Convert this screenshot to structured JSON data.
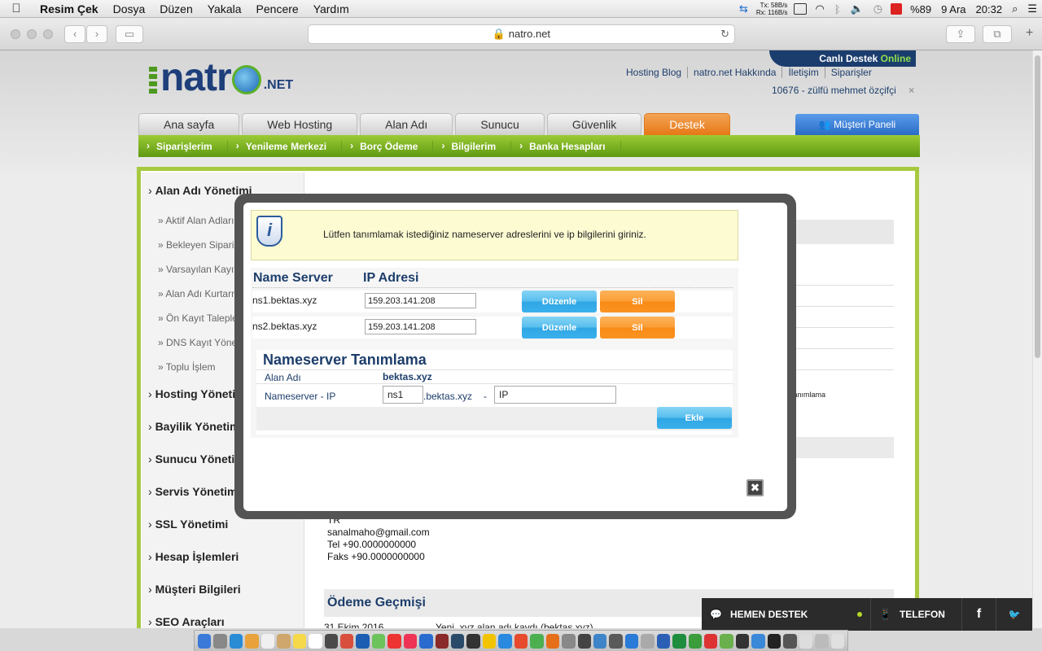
{
  "menubar": {
    "app": "Resim Çek",
    "items": [
      "Dosya",
      "Düzen",
      "Yakala",
      "Pencere",
      "Yardım"
    ],
    "net_tx_label": "Tx:",
    "net_rx_label": "Rx:",
    "net_tx": "58B/s",
    "net_rx": "116B/s",
    "battery": "%89",
    "date": "9 Ara",
    "time": "20:32"
  },
  "browser": {
    "url": "natro.net"
  },
  "site": {
    "logo_word": "natr",
    "logo_suffix": ".NET",
    "canli_prefix": "Canlı Destek",
    "canli_status": "Online",
    "toplinks": [
      "Hosting Blog",
      "natro.net Hakkında",
      "İletişim",
      "Siparişler"
    ],
    "user": "10676 - zülfü mehmet özçifçi",
    "close_mark": "×",
    "tabs": [
      "Ana sayfa",
      "Web Hosting",
      "Alan Adı",
      "Sunucu",
      "Güvenlik",
      "Destek"
    ],
    "subnav": [
      "Siparişlerim",
      "Yenileme Merkezi",
      "Borç Ödeme",
      "Bilgilerim",
      "Banka Hesapları"
    ],
    "musteri_paneli": "Müşteri Paneli"
  },
  "sidebar": {
    "heading_main": "Alan Adı Yönetimi",
    "sub_items": [
      "Aktif Alan Adları",
      "Bekleyen Siparişler",
      "Varsayılan Kayıt Bilgileri",
      "Alan Adı Kurtarma",
      "Ön Kayıt Talepleri",
      "DNS Kayıt Yönetimi",
      "Toplu İşlem"
    ],
    "headings": [
      "Hosting Yönetimi",
      "Bayilik Yönetimi",
      "Sunucu Yönetimi",
      "Servis Yönetimi",
      "SSL Yönetimi",
      "Hesap İşlemleri",
      "Müşteri Bilgileri",
      "SEO Araçları"
    ]
  },
  "background": {
    "country": "TR",
    "email": "sanalmaho@gmail.com",
    "tel": "Tel +90.0000000000",
    "faks": "Faks +90.0000000000",
    "odeme_title": "Ödeme Geçmişi",
    "odeme_date": "31 Ekim 2016",
    "odeme_desc": "Yeni .xyz alan adı kaydı (bektas.xyz)",
    "tanimlama": "Tanımlama"
  },
  "modal": {
    "info_message": "Lütfen tanımlamak istediğiniz nameserver adreslerini ve ip bilgilerini giriniz.",
    "col_ns": "Name Server",
    "col_ip": "IP Adresi",
    "rows": [
      {
        "ns": "ns1.bektas.xyz",
        "ip": "159.203.141.208"
      },
      {
        "ns": "ns2.bektas.xyz",
        "ip": "159.203.141.208"
      }
    ],
    "edit_label": "Düzenle",
    "delete_label": "Sil",
    "define_title": "Nameserver Tanımlama",
    "domain_label": "Alan Adı",
    "domain_value": "bektas.xyz",
    "ns_ip_label": "Nameserver - IP",
    "ns_prefix_value": "ns1",
    "ns_suffix": ".bektas.xyz",
    "dash": "-",
    "ip_value": "IP",
    "add_label": "Ekle",
    "close_mark": "✖"
  },
  "support_bar": {
    "hemen": "HEMEN DESTEK",
    "telefon": "TELEFON",
    "facebook": "f"
  }
}
